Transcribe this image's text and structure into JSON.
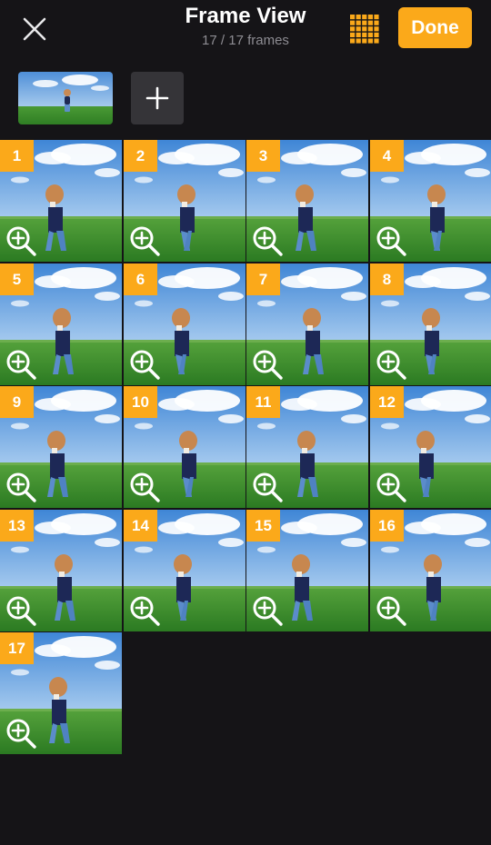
{
  "header": {
    "title": "Frame View",
    "subtitle": "17 / 17 frames",
    "done_label": "Done",
    "close_icon": "close-icon",
    "grid_icon": "grid-view-icon"
  },
  "strip": {
    "add_icon": "plus-icon"
  },
  "frames": [
    "1",
    "2",
    "3",
    "4",
    "5",
    "6",
    "7",
    "8",
    "9",
    "10",
    "11",
    "12",
    "13",
    "14",
    "15",
    "16",
    "17"
  ],
  "colors": {
    "accent": "#FBA91A",
    "background": "#151417",
    "button_gray": "#353438",
    "subtitle": "#8D8C92"
  }
}
